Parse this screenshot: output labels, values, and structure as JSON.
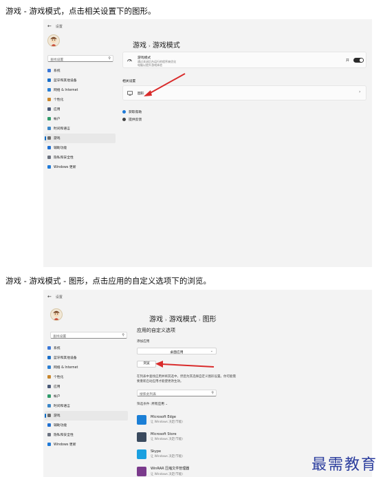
{
  "captions": {
    "step1": "游戏 - 游戏模式，点击相关设置下的图形。",
    "step2": "游戏 - 游戏模式 - 图形，点击应用的自定义选项下的浏览。"
  },
  "window": {
    "title": "设置"
  },
  "sidebar": {
    "search_placeholder": "查找设置",
    "items": [
      {
        "label": "系统",
        "color": "#3b78d8"
      },
      {
        "label": "蓝牙和其他设备",
        "color": "#1a6fc9"
      },
      {
        "label": "网络 & Internet",
        "color": "#2a7fd4"
      },
      {
        "label": "个性化",
        "color": "#c9862b"
      },
      {
        "label": "应用",
        "color": "#4a5a78"
      },
      {
        "label": "帐户",
        "color": "#2e9c6a"
      },
      {
        "label": "时间和语言",
        "color": "#3a86c8"
      },
      {
        "label": "游戏",
        "color": "#6b6b6b",
        "active": true
      },
      {
        "label": "辅助功能",
        "color": "#1f6fd1"
      },
      {
        "label": "隐私和安全性",
        "color": "#6b7280"
      },
      {
        "label": "Windows 更新",
        "color": "#1f7ad8"
      }
    ]
  },
  "screen1": {
    "breadcrumb": [
      "游戏",
      "游戏模式"
    ],
    "game_mode": {
      "title": "游戏模式",
      "subtitle_1": "通过关闭后台运行的程序来优化",
      "subtitle_2": "电脑以提升游戏体验",
      "toggle_label": "开",
      "toggle_on": true
    },
    "related_label": "相关设置",
    "graphics_label": "图形",
    "links": [
      {
        "label": "获取帮助",
        "color": "#1f7ad8"
      },
      {
        "label": "提供反馈",
        "color": "#444444"
      }
    ]
  },
  "screen2": {
    "breadcrumb": [
      "游戏",
      "游戏模式",
      "图形"
    ],
    "custom_options_title": "应用的自定义选项",
    "add_app_label": "添加应用",
    "add_app_select": "桌面应用",
    "browse_label": "浏览",
    "description_1": "在列表中查找应用并将其选中，然后为其选择自定义图形设置。你可能需",
    "description_2": "要重新启动应用才能使更改生效。",
    "search_list_placeholder": "搜索此列表",
    "filter_label": "筛选条件:",
    "filter_value": "所有应用",
    "apps": [
      {
        "name": "Microsoft Edge",
        "pref": "让 Windows 决定(节能)",
        "color": "#1b7fd6",
        "icon": "edge-icon"
      },
      {
        "name": "Microsoft Store",
        "pref": "让 Windows 决定(节能)",
        "color": "#3a4a5e",
        "icon": "store-icon"
      },
      {
        "name": "Skype",
        "pref": "让 Windows 决定(节能)",
        "color": "#1aa0e0",
        "icon": "skype-icon"
      },
      {
        "name": "WinRAR 压缩文件管理器",
        "pref": "让 Windows 决定(节能)",
        "color": "#7a3a8c",
        "icon": "winrar-icon"
      }
    ]
  },
  "watermark": "最需教育"
}
